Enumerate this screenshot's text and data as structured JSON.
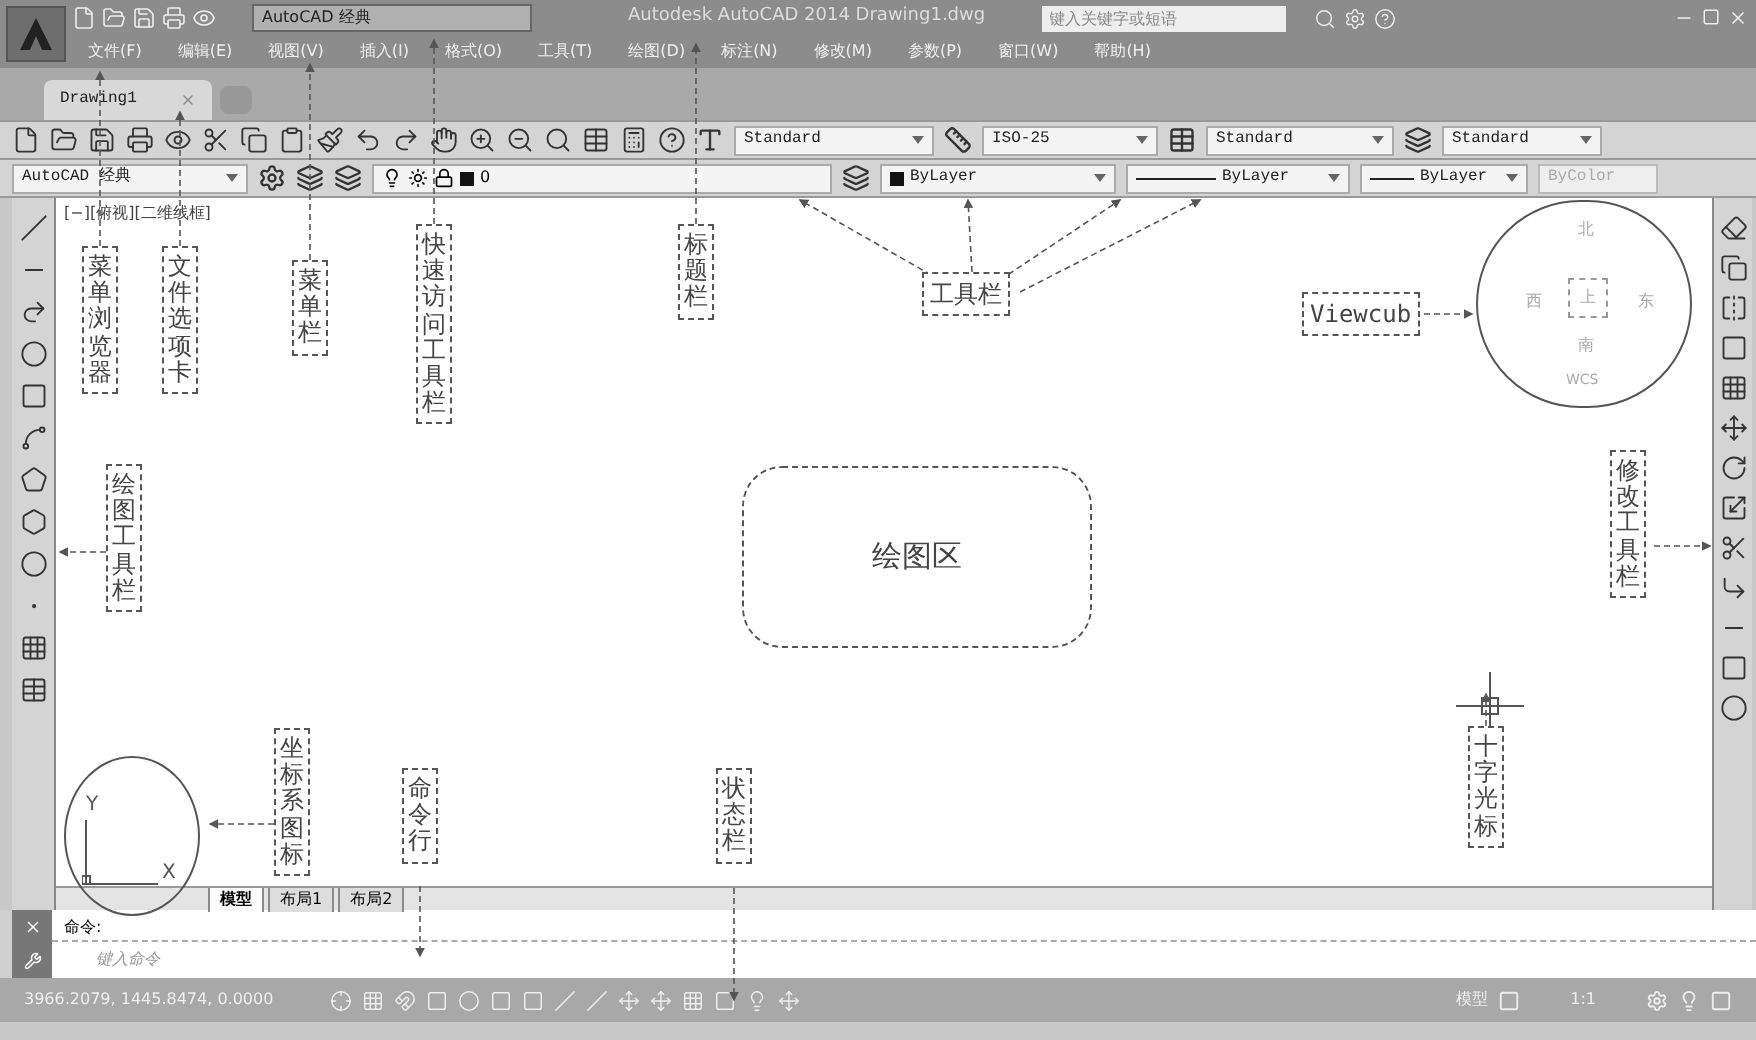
{
  "title_bar": {
    "workspace": "AutoCAD 经典",
    "title": "Autodesk AutoCAD 2014  Drawing1.dwg",
    "search": {
      "placeholder": "键入关键字或短语"
    }
  },
  "menu_bar": [
    "文件(F)",
    "编辑(E)",
    "视图(V)",
    "插入(I)",
    "格式(O)",
    "工具(T)",
    "绘图(D)",
    "标注(N)",
    "修改(M)",
    "参数(P)",
    "窗口(W)",
    "帮助(H)"
  ],
  "file_tabs": [
    {
      "label": "Drawing1",
      "selected": true
    }
  ],
  "toolbar": {
    "text_style": "Standard",
    "dim_style": "ISO-25",
    "table_style": "Standard",
    "mleader_style": "Standard"
  },
  "properties_bar": {
    "workspace": "AutoCAD 经典",
    "layer": "0",
    "color_dropdown": "ByLayer",
    "linetype": "ByLayer",
    "lineweight": "ByLayer",
    "plot_style": "ByColor"
  },
  "viewport_label": "[−][俯视][二维线框]",
  "viewcube": {
    "north": "北",
    "west": "西",
    "top": "上",
    "east": "东",
    "south": "南",
    "ucs": "WCS"
  },
  "ucs_icon": {
    "y": "Y",
    "x": "X"
  },
  "callouts": [
    {
      "kind": "vertical",
      "text": "菜单浏览器"
    },
    {
      "kind": "vertical",
      "text": "文件选项卡"
    },
    {
      "kind": "vertical",
      "text": "菜单栏"
    },
    {
      "kind": "vertical",
      "text": "快速访问工具栏"
    },
    {
      "kind": "vertical",
      "text": "标题栏"
    },
    {
      "kind": "horizontal",
      "text": "工具栏"
    },
    {
      "kind": "horizontal",
      "text": "Viewcub"
    },
    {
      "kind": "vertical",
      "text": "绘图工具栏"
    },
    {
      "kind": "area",
      "text": "绘图区"
    },
    {
      "kind": "vertical",
      "text": "修改工具栏"
    },
    {
      "kind": "vertical",
      "text": "十字光标"
    },
    {
      "kind": "vertical",
      "text": "坐标系图标"
    },
    {
      "kind": "vertical",
      "text": "命令行"
    },
    {
      "kind": "vertical",
      "text": "状态栏"
    }
  ],
  "layout_tabs": [
    {
      "label": "模型",
      "selected": true
    },
    {
      "label": "布局1",
      "selected": false
    },
    {
      "label": "布局2",
      "selected": false
    }
  ],
  "command_line": {
    "history": "命令:",
    "placeholder": "键入命令"
  },
  "status_bar": {
    "coordinates": "3966.2079, 1445.8474, 0.0000",
    "model": "模型",
    "scale": "1:1"
  }
}
